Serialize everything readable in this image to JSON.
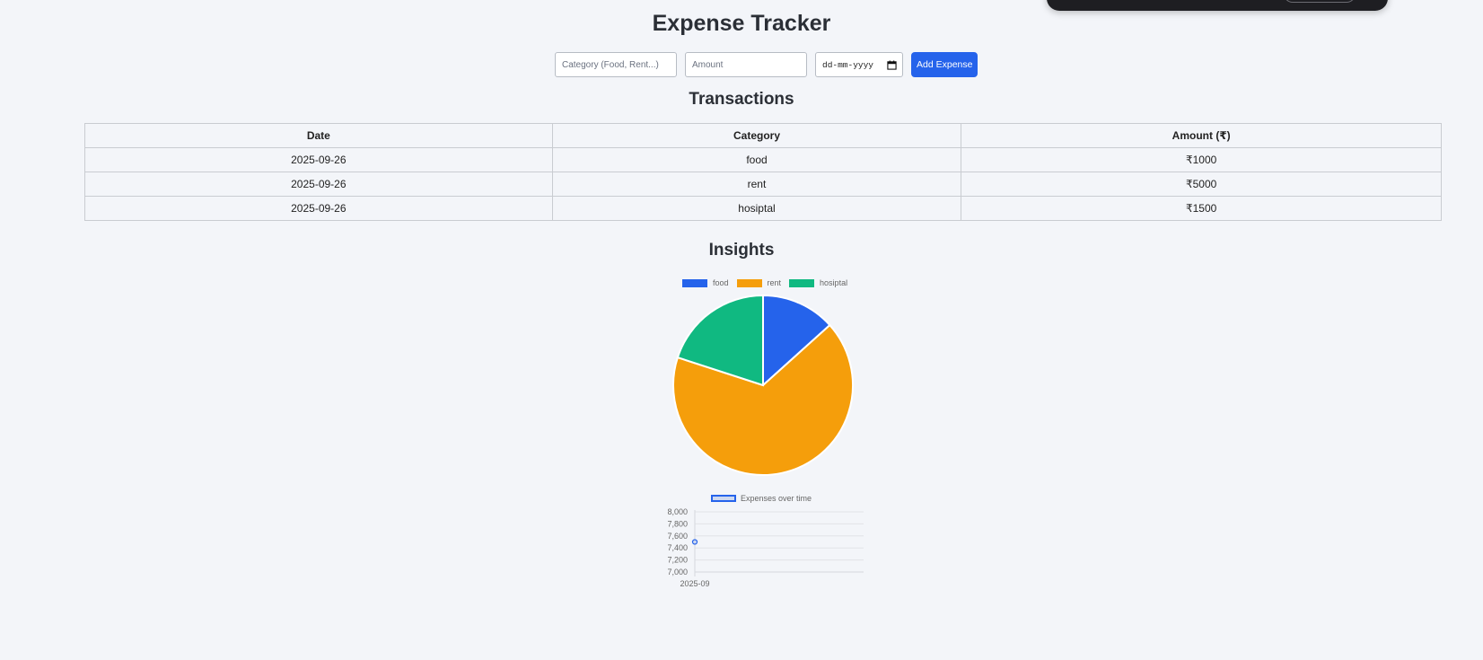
{
  "app": {
    "title": "Expense Tracker"
  },
  "form": {
    "category_placeholder": "Category (Food, Rent...)",
    "amount_placeholder": "Amount",
    "date_placeholder": "dd-mm-yyyy",
    "add_button_label": "Add Expense"
  },
  "transactions": {
    "heading": "Transactions",
    "columns": [
      "Date",
      "Category",
      "Amount (₹)"
    ],
    "rows": [
      {
        "date": "2025-09-26",
        "category": "food",
        "amount": "₹1000"
      },
      {
        "date": "2025-09-26",
        "category": "rent",
        "amount": "₹5000"
      },
      {
        "date": "2025-09-26",
        "category": "hosiptal",
        "amount": "₹1500"
      }
    ]
  },
  "insights": {
    "heading": "Insights"
  },
  "colors": {
    "accent": "#2563eb",
    "food": "#2563eb",
    "rent": "#f59e0b",
    "hosiptal": "#10b981"
  },
  "chart_data": [
    {
      "type": "pie",
      "categories": [
        "food",
        "rent",
        "hosiptal"
      ],
      "values": [
        1000,
        5000,
        1500
      ],
      "colors": [
        "#2563eb",
        "#f59e0b",
        "#10b981"
      ],
      "legend": "top"
    },
    {
      "type": "line",
      "series": [
        {
          "name": "Expenses over time",
          "x": [
            "2025-09"
          ],
          "values": [
            7500
          ]
        }
      ],
      "x_tick_labels": [
        "2025-09"
      ],
      "ylim": [
        7000,
        8000
      ],
      "y_ticks": [
        "8,000",
        "7,800",
        "7,600",
        "7,400",
        "7,200",
        "7,000"
      ],
      "grid": true,
      "legend": "top"
    }
  ]
}
